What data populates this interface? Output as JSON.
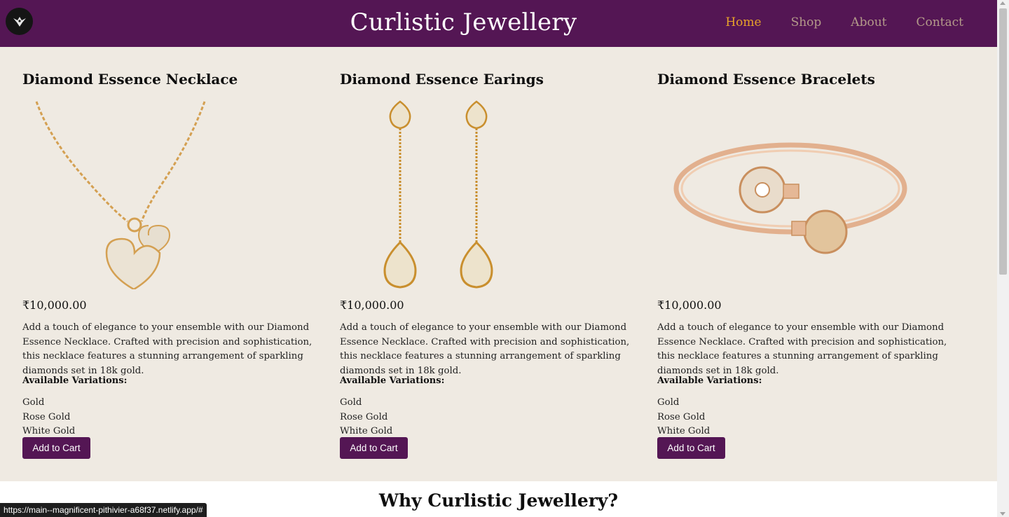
{
  "header": {
    "site_title": "Curlistic Jewellery",
    "nav": [
      "Home",
      "Shop",
      "About",
      "Contact"
    ]
  },
  "products": [
    {
      "name": "Diamond Essence Necklace",
      "price": "₹10,000.00",
      "description": "Add a touch of elegance to your ensemble with our Diamond Essence Necklace. Crafted with precision and sophistication, this necklace features a stunning arrangement of sparkling diamonds set in 18k gold.",
      "variations_title": "Available Variations:",
      "variations": [
        "Gold",
        "Rose Gold",
        "White Gold"
      ],
      "button": "Add to Cart",
      "image_icon": "necklace-image"
    },
    {
      "name": "Diamond Essence Earings",
      "price": "₹10,000.00",
      "description": "Add a touch of elegance to your ensemble with our Diamond Essence Necklace. Crafted with precision and sophistication, this necklace features a stunning arrangement of sparkling diamonds set in 18k gold.",
      "variations_title": "Available Variations:",
      "variations": [
        "Gold",
        "Rose Gold",
        "White Gold"
      ],
      "button": "Add to Cart",
      "image_icon": "earrings-image"
    },
    {
      "name": "Diamond Essence Bracelets",
      "price": "₹10,000.00",
      "description": "Add a touch of elegance to your ensemble with our Diamond Essence Necklace. Crafted with precision and sophistication, this necklace features a stunning arrangement of sparkling diamonds set in 18k gold.",
      "variations_title": "Available Variations:",
      "variations": [
        "Gold",
        "Rose Gold",
        "White Gold"
      ],
      "button": "Add to Cart",
      "image_icon": "bracelet-image"
    }
  ],
  "why_section": {
    "title": "Why Curlistic Jewellery?"
  },
  "status_bar": {
    "url": "https://main--magnificent-pithivier-a68f37.netlify.app/#"
  },
  "colors": {
    "brand": "#541654",
    "background": "#efeae2",
    "nav_active": "#e7a32a",
    "nav_inactive": "#b49b8a"
  }
}
